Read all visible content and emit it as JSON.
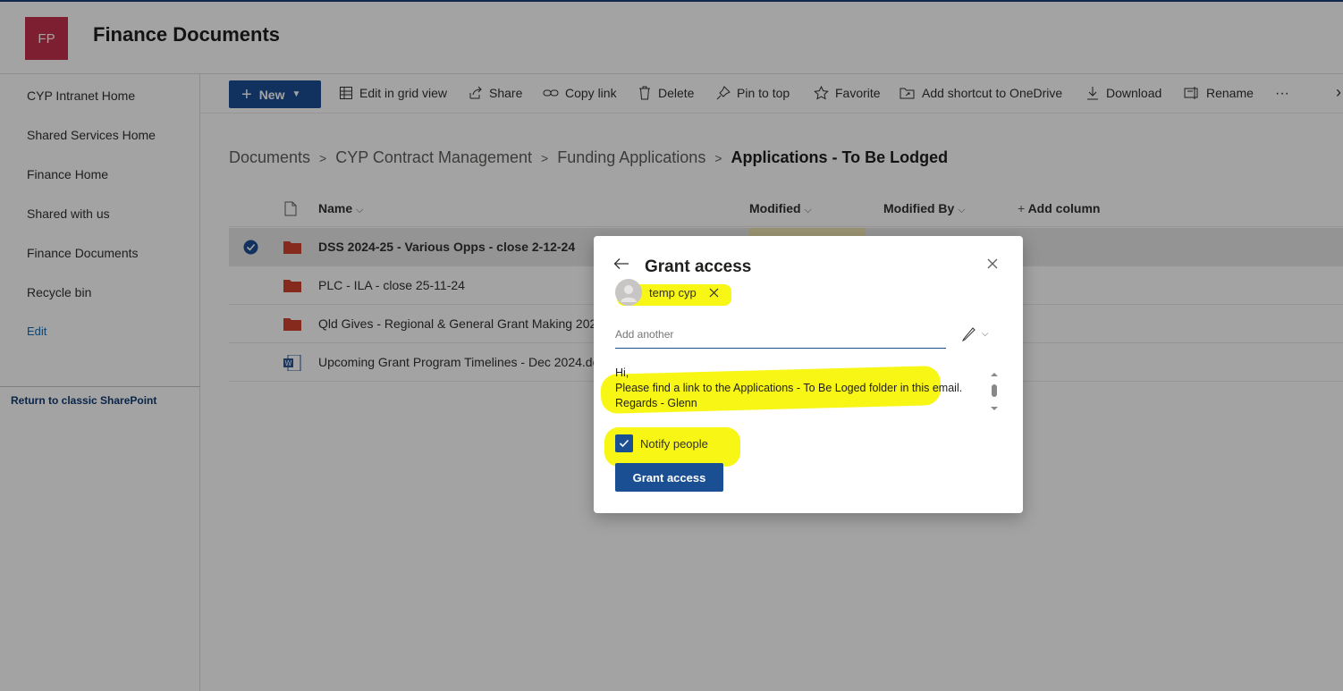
{
  "header": {
    "logo_initials": "FP",
    "site_title": "Finance Documents",
    "logo_color": "#c4314b"
  },
  "leftnav": {
    "items": [
      "CYP Intranet Home",
      "Shared Services Home",
      "Finance Home",
      "Shared with us",
      "Finance Documents",
      "Recycle bin"
    ],
    "edit_label": "Edit",
    "classic_link": "Return to classic SharePoint"
  },
  "commandbar": {
    "new_label": "New",
    "edit_grid": "Edit in grid view",
    "share": "Share",
    "copy_link": "Copy link",
    "delete": "Delete",
    "pin": "Pin to top",
    "favorite": "Favorite",
    "shortcut": "Add shortcut to OneDrive",
    "download": "Download",
    "rename": "Rename",
    "more": "···",
    "overflow": "›"
  },
  "breadcrumb": {
    "items": [
      "Documents",
      "CYP Contract Management",
      "Funding Applications"
    ],
    "current": "Applications - To Be Lodged"
  },
  "list": {
    "columns": {
      "name": "Name",
      "modified": "Modified",
      "modified_by": "Modified By",
      "add_column": "Add column"
    },
    "rows": [
      {
        "name": "DSS 2024-25 - Various Opps - close 2-12-24",
        "type": "folder",
        "selected": true
      },
      {
        "name": "PLC - ILA - close 25-11-24",
        "type": "folder",
        "selected": false
      },
      {
        "name": "Qld Gives - Regional & General Grant Making 2024",
        "type": "folder",
        "selected": false
      },
      {
        "name": "Upcoming Grant Program Timelines - Dec 2024.docx",
        "type": "word",
        "selected": false
      }
    ]
  },
  "dialog": {
    "title": "Grant access",
    "recipient": "temp cyp",
    "add_another_placeholder": "Add another",
    "message": {
      "line1": "Hi,",
      "line2": "Please find a link to the Applications - To Be Loged folder in this email.",
      "line3": "Regards - Glenn"
    },
    "notify_label": "Notify people",
    "notify_checked": true,
    "grant_button": "Grant access"
  },
  "colors": {
    "accent": "#1b4f93",
    "highlight": "#f7f500",
    "folder": "#d2432f"
  }
}
